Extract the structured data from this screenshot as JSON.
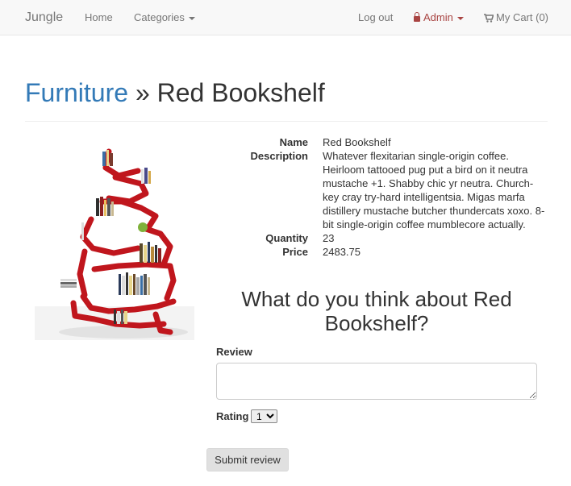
{
  "navbar": {
    "brand": "Jungle",
    "home": "Home",
    "categories": "Categories",
    "logout": "Log out",
    "admin": "Admin",
    "cart": "My Cart (0)"
  },
  "header": {
    "category": "Furniture",
    "separator": "»",
    "product": "Red Bookshelf"
  },
  "details": {
    "name_label": "Name",
    "name": "Red Bookshelf",
    "description_label": "Description",
    "description": "Whatever flexitarian single-origin coffee. Heirloom tattooed pug put a bird on it neutra mustache +1. Shabby chic yr neutra. Church-key cray try-hard intelligentsia. Migas marfa distillery mustache butcher thundercats xoxo. 8-bit single-origin coffee mumblecore actually.",
    "quantity_label": "Quantity",
    "quantity": "23",
    "price_label": "Price",
    "price": "2483.75"
  },
  "review": {
    "heading": "What do you think about Red Bookshelf?",
    "review_label": "Review",
    "review_value": "",
    "rating_label": "Rating",
    "rating_value": "1",
    "submit": "Submit review"
  },
  "colors": {
    "link": "#337ab7",
    "admin": "#a94442",
    "shelf_red": "#c0161d"
  }
}
